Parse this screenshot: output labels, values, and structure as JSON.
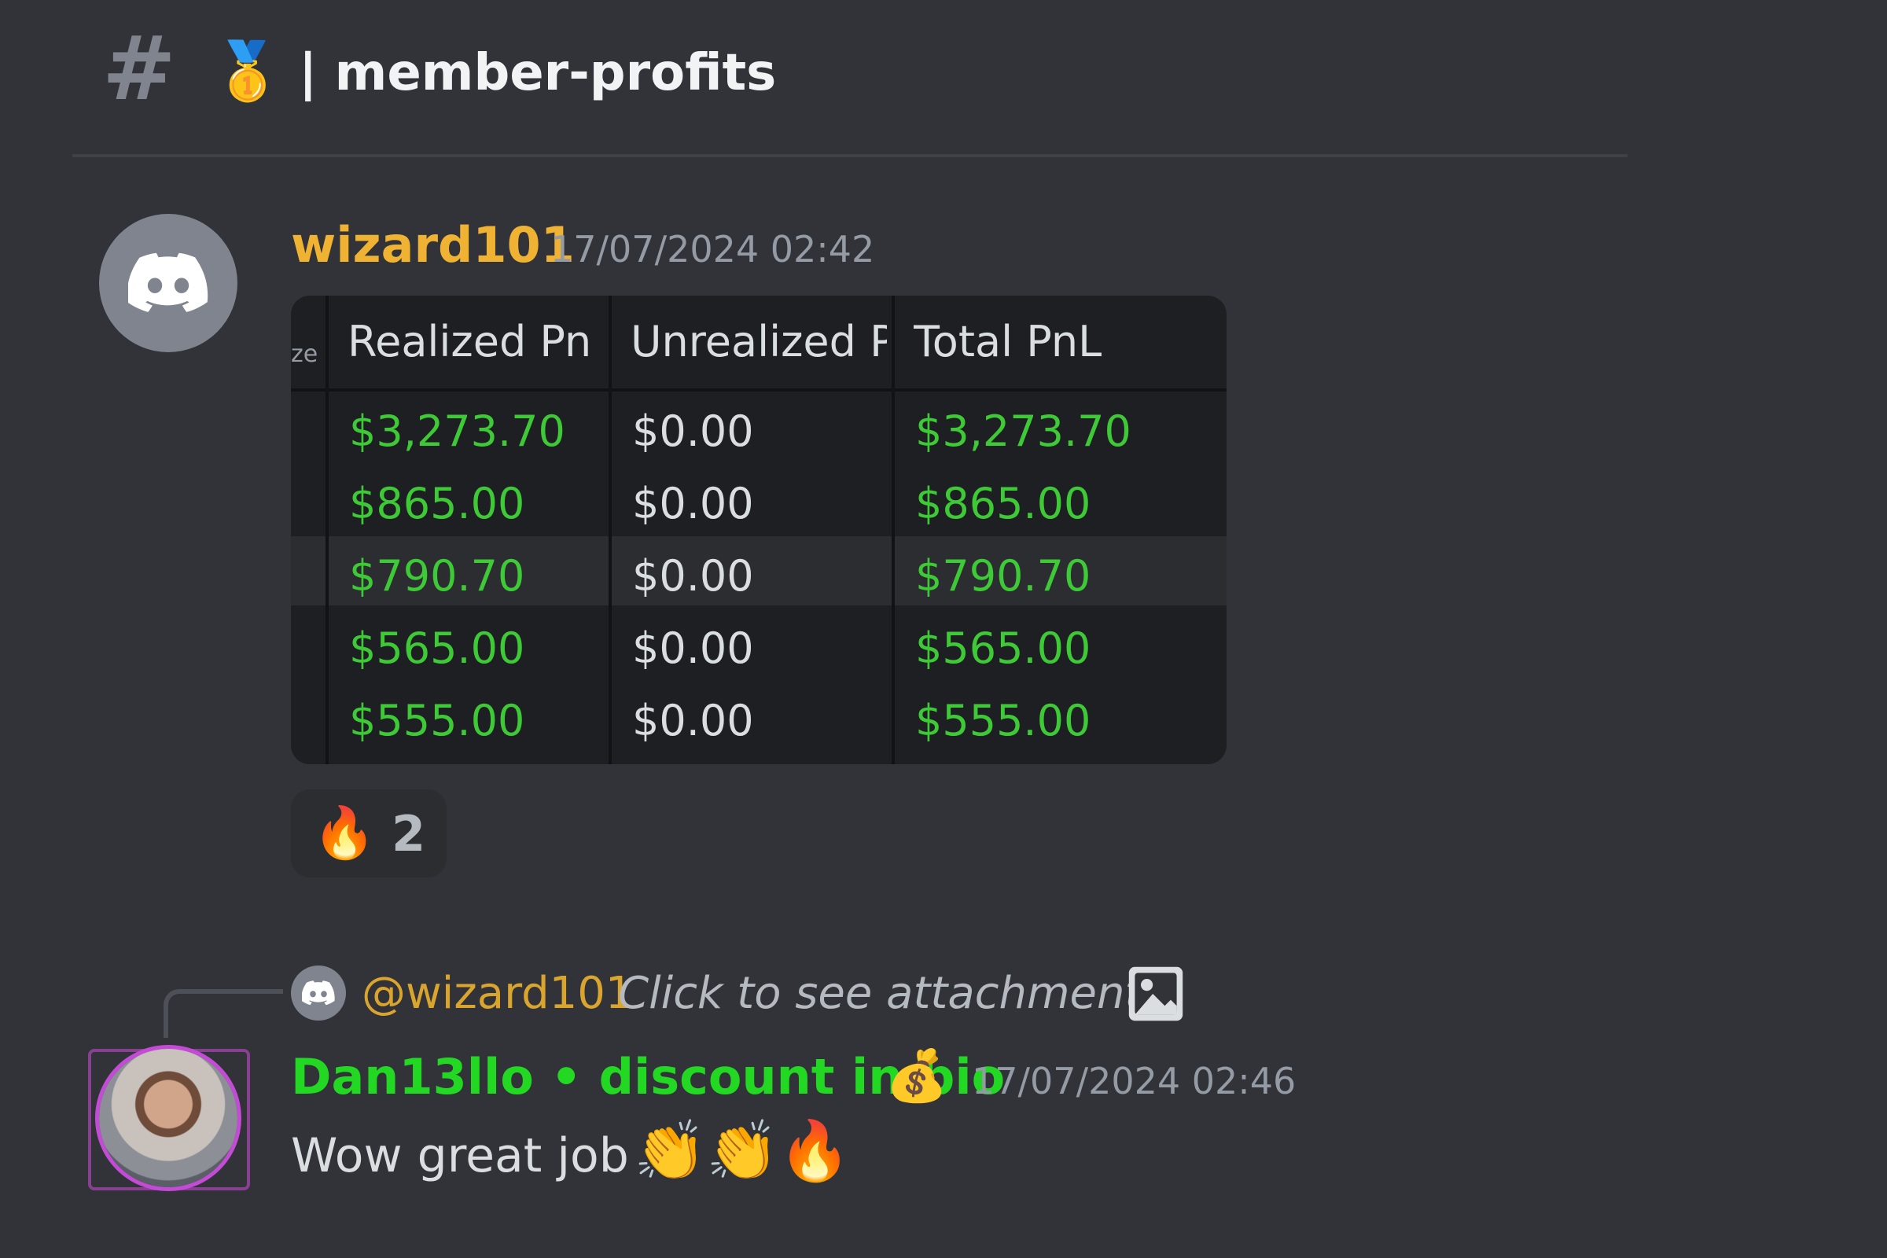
{
  "channel": {
    "hash": "#",
    "emoji": "🥇",
    "name": "| member-profits"
  },
  "message1": {
    "author": "wizard101",
    "timestamp": "17/07/2024 02:42",
    "table": {
      "headers": [
        "ze",
        "Realized Pn",
        "Unrealized P",
        "Total PnL"
      ],
      "rows": [
        {
          "realized": "$3,273.70",
          "unrealized": "$0.00",
          "total": "$3,273.70"
        },
        {
          "realized": "$865.00",
          "unrealized": "$0.00",
          "total": "$865.00"
        },
        {
          "realized": "$790.70",
          "unrealized": "$0.00",
          "total": "$790.70"
        },
        {
          "realized": "$565.00",
          "unrealized": "$0.00",
          "total": "$565.00"
        },
        {
          "realized": "$555.00",
          "unrealized": "$0.00",
          "total": "$555.00"
        }
      ]
    },
    "reaction": {
      "emoji": "🔥",
      "count": "2"
    }
  },
  "reply": {
    "mention": "@wizard101",
    "preview": "Click to see attachment"
  },
  "message2": {
    "author": "Dan13llo • discount in bio",
    "author_emoji": "💰",
    "timestamp": "17/07/2024 02:46",
    "text": "Wow great job",
    "emojis": "👏👏🔥"
  },
  "colors": {
    "background": "#313338",
    "author1": "#f0b232",
    "author2": "#23d823",
    "profit_green": "#3ec936"
  }
}
